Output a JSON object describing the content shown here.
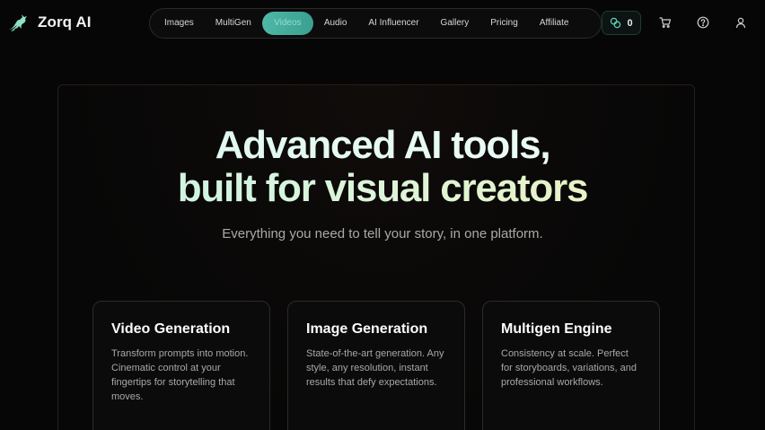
{
  "brand": {
    "name": "Zorq AI",
    "logo_icon": "leaping-deer-icon",
    "accent": "#4fb8a6"
  },
  "nav": {
    "items": [
      {
        "label": "Images",
        "active": false
      },
      {
        "label": "MultiGen",
        "active": false
      },
      {
        "label": "Videos",
        "active": true
      },
      {
        "label": "Audio",
        "active": false
      },
      {
        "label": "AI Influencer",
        "active": false
      },
      {
        "label": "Gallery",
        "active": false
      },
      {
        "label": "Pricing",
        "active": false
      },
      {
        "label": "Affiliate",
        "active": false
      }
    ]
  },
  "header": {
    "credits": {
      "icon": "coins-icon",
      "count": "0"
    },
    "icons": [
      "cart-icon",
      "help-icon",
      "user-icon"
    ]
  },
  "hero": {
    "headline_line1": "Advanced AI tools,",
    "headline_line2": "built for visual creators",
    "subhead": "Everything you need to tell your story, in one platform."
  },
  "features": [
    {
      "title": "Video Generation",
      "body": "Transform prompts into motion. Cinematic control at your fingertips for storytelling that moves."
    },
    {
      "title": "Image Generation",
      "body": "State-of-the-art generation. Any style, any resolution, instant results that defy expectations."
    },
    {
      "title": "Multigen Engine",
      "body": "Consistency at scale. Perfect for storyboards, variations, and professional workflows."
    }
  ]
}
